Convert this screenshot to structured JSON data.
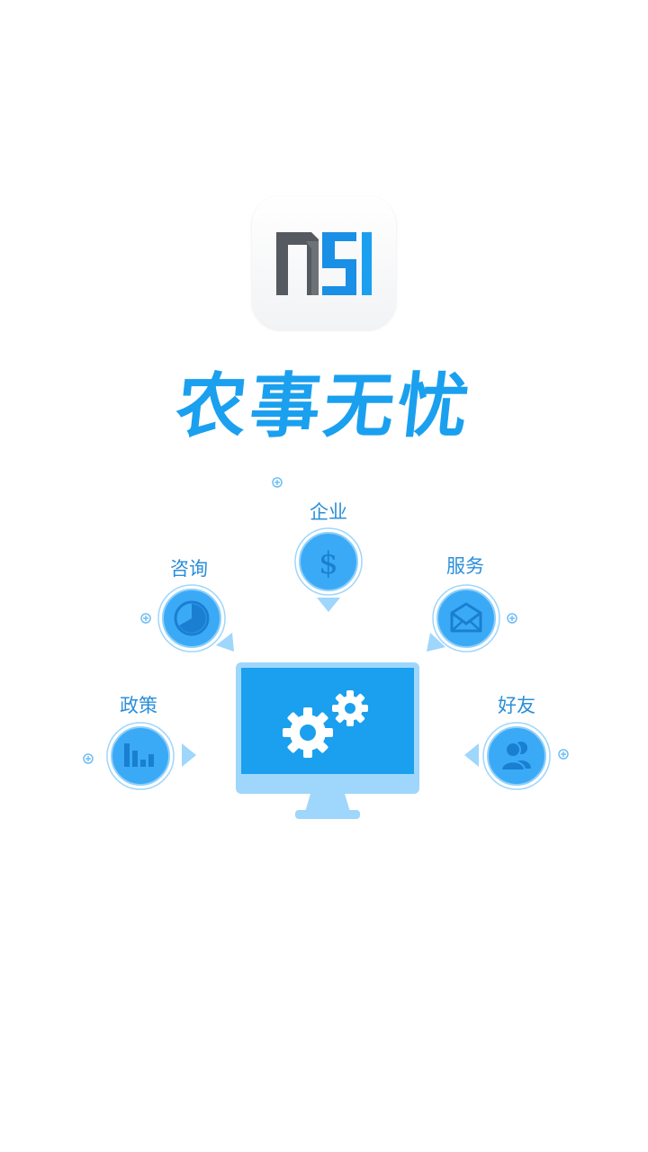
{
  "app": {
    "logo_text": "nSI",
    "slogan": "农事无忧"
  },
  "features": [
    {
      "id": "enterprise",
      "label": "企业",
      "icon": "dollar-icon"
    },
    {
      "id": "consult",
      "label": "咨询",
      "icon": "radar-icon"
    },
    {
      "id": "service",
      "label": "服务",
      "icon": "mail-icon"
    },
    {
      "id": "policy",
      "label": "政策",
      "icon": "bar-chart-icon"
    },
    {
      "id": "friends",
      "label": "好友",
      "icon": "users-icon"
    }
  ],
  "colors": {
    "brand_blue": "#1aa0ef",
    "node_fill": "#3aaaf6",
    "light_blue": "#9fd6fb",
    "logo_gray": "#555a60"
  }
}
